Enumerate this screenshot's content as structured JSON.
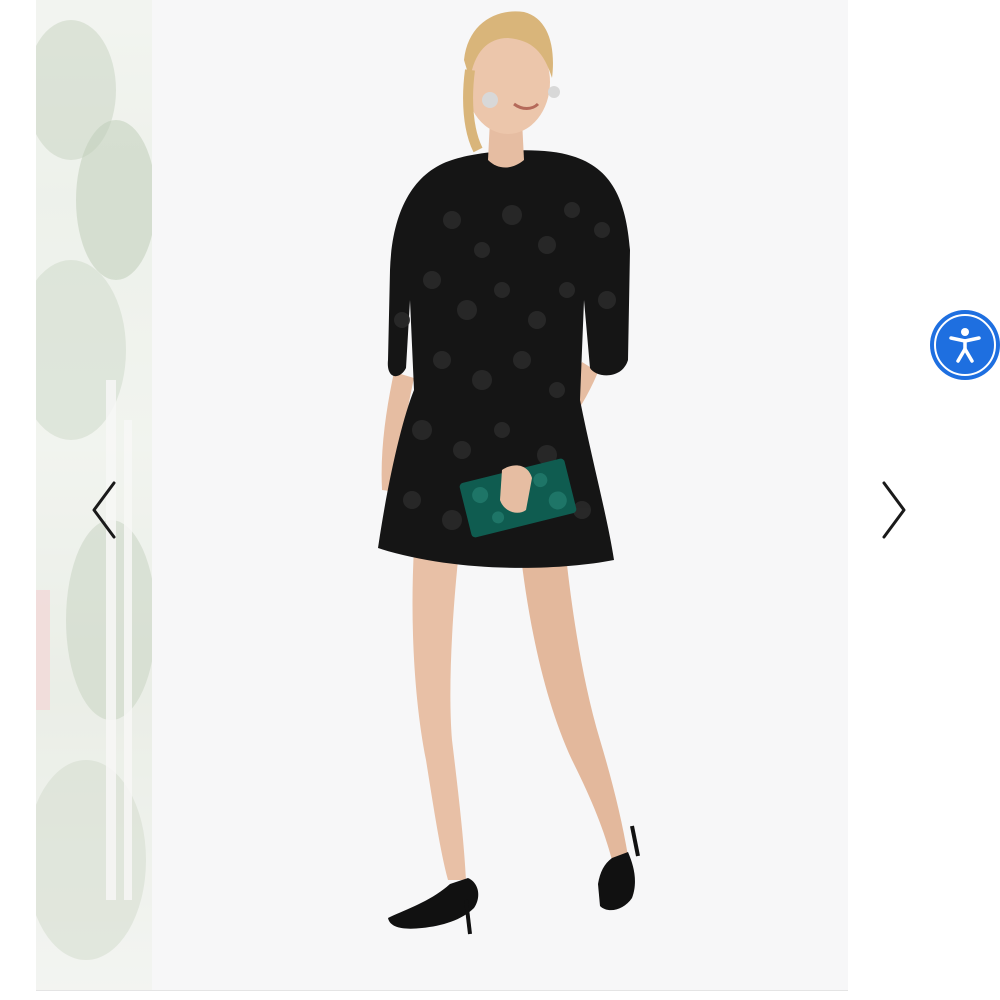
{
  "carousel": {
    "current_slide_description_icon": "product-photo",
    "prev_arrow_icon": "chevron-left-icon",
    "next_arrow_icon": "chevron-right-icon"
  },
  "accessibility": {
    "icon": "accessibility-person-icon",
    "color": "#1e6fe0"
  },
  "colors": {
    "dress": "#151515",
    "clutch": "#0f5c50",
    "background": "#f7f7f8"
  }
}
